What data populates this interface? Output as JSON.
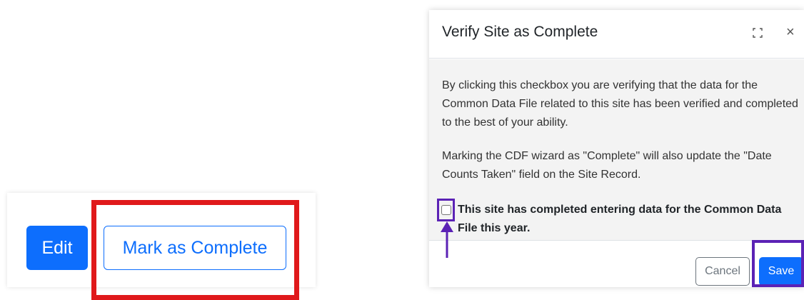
{
  "left_panel": {
    "edit_label": "Edit",
    "mark_complete_label": "Mark as Complete"
  },
  "modal": {
    "title": "Verify Site as Complete",
    "paragraph1": "By clicking this checkbox you are verifying that the data for the Common Data File related to this site has been verified and completed to the best of your ability.",
    "paragraph2": "Marking the CDF wizard as \"Complete\" will also update the \"Date Counts Taken\" field on the Site Record.",
    "checkbox_label": "This site has completed entering data for the Common Data File this year.",
    "checkbox_checked": false,
    "cancel_label": "Cancel",
    "save_label": "Save",
    "expand_icon": "expand-icon",
    "close_icon": "×"
  },
  "colors": {
    "primary": "#0d6efd",
    "highlight_red": "#e0191b",
    "highlight_purple": "#5b22b5",
    "modal_body_bg": "#f3f3f3"
  }
}
